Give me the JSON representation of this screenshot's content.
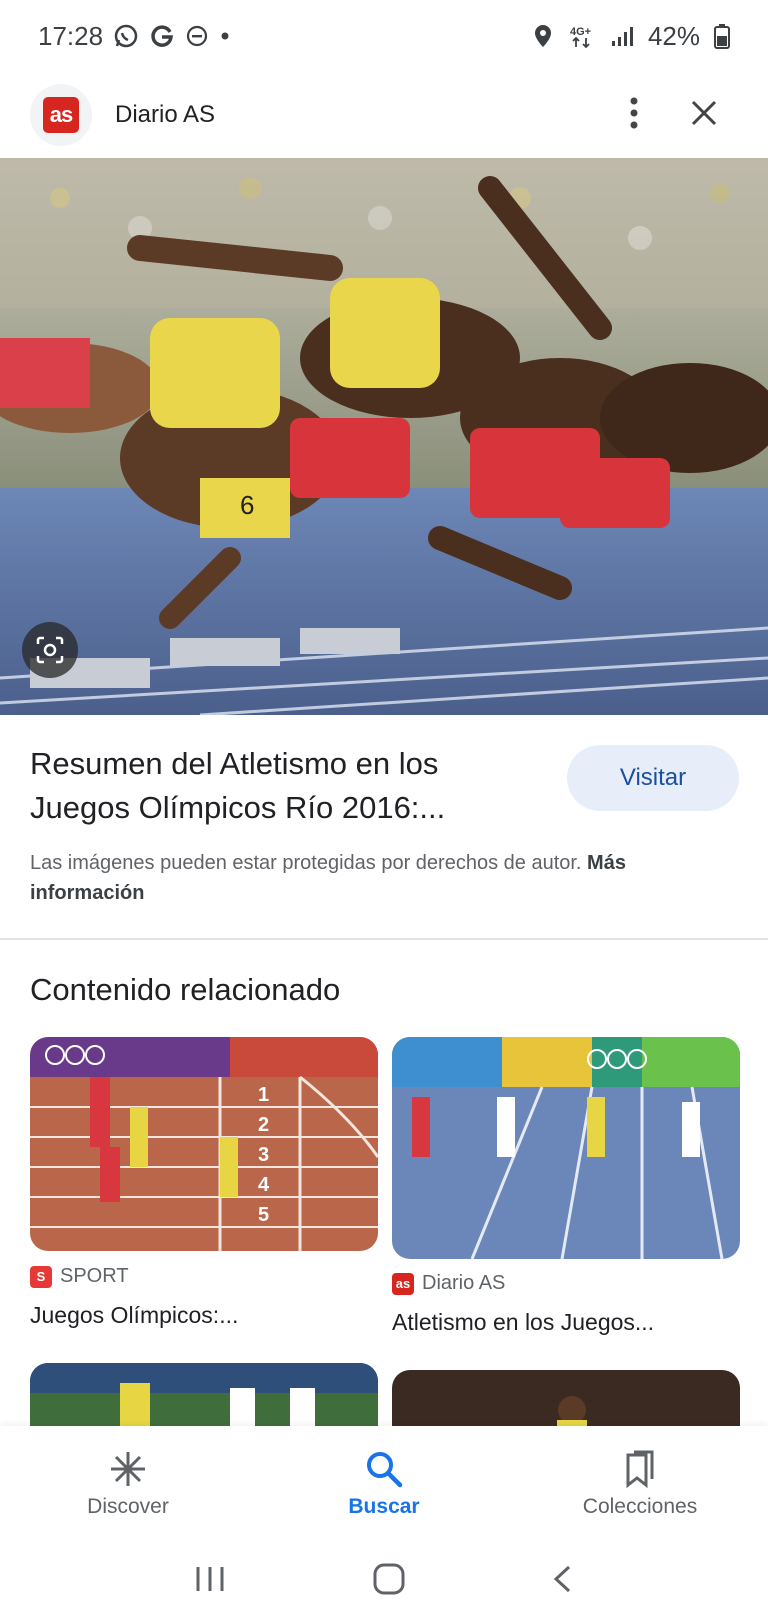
{
  "status_bar": {
    "time": "17:28",
    "battery": "42%",
    "network": "4G+"
  },
  "header": {
    "logo_text": "as",
    "site_name": "Diario AS"
  },
  "result": {
    "title": "Resumen del Atletismo en los Juegos Olímpicos Río 2016:...",
    "visit_label": "Visitar",
    "copyright_text": "Las imágenes pueden estar protegidas por derechos de autor.",
    "more_info_label": "Más información"
  },
  "related": {
    "heading": "Contenido relacionado",
    "cards": [
      {
        "source": "SPORT",
        "source_icon": "S",
        "title": "Juegos Olímpicos:..."
      },
      {
        "source": "Diario AS",
        "source_icon": "as",
        "title": "Atletismo en los Juegos..."
      }
    ]
  },
  "bottom_nav": {
    "items": [
      {
        "label": "Discover",
        "icon": "asterisk-icon"
      },
      {
        "label": "Buscar",
        "icon": "search-icon"
      },
      {
        "label": "Colecciones",
        "icon": "bookmarks-icon"
      }
    ],
    "active": "Buscar"
  },
  "colors": {
    "accent": "#1a73e8",
    "brand_red": "#d6261f",
    "visit_bg": "#e8eef9"
  }
}
